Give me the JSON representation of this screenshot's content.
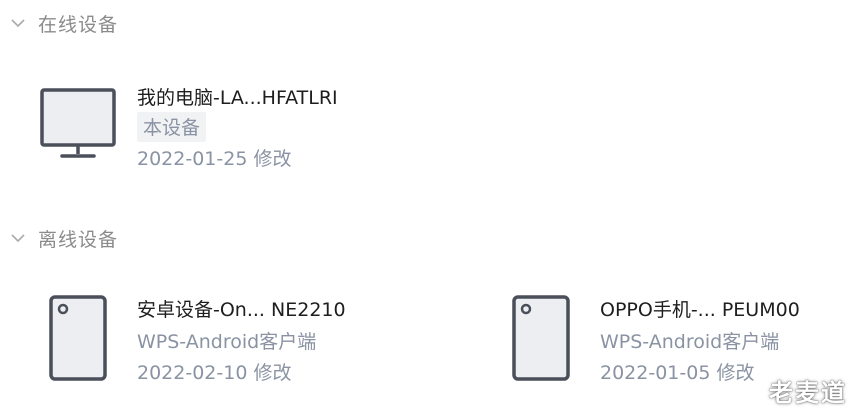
{
  "online_section": {
    "title": "在线设备",
    "devices": [
      {
        "name": "我的电脑-LA...HFATLRI",
        "badge": "本设备",
        "date": "2022-01-25 修改",
        "icon": "monitor-icon"
      }
    ]
  },
  "offline_section": {
    "title": "离线设备",
    "devices": [
      {
        "name": "安卓设备-On... NE2210",
        "client": "WPS-Android客户端",
        "date": "2022-02-10 修改",
        "icon": "tablet-icon"
      },
      {
        "name": "OPPO手机-... PEUM00",
        "client": "WPS-Android客户端",
        "date": "2022-01-05 修改",
        "icon": "tablet-icon"
      }
    ]
  },
  "watermark": "老麦道",
  "colors": {
    "icon_stroke": "#4a4f5a",
    "icon_fill": "#eceef2",
    "secondary_text": "#8a93a3",
    "section_title": "#8b8b8b"
  }
}
